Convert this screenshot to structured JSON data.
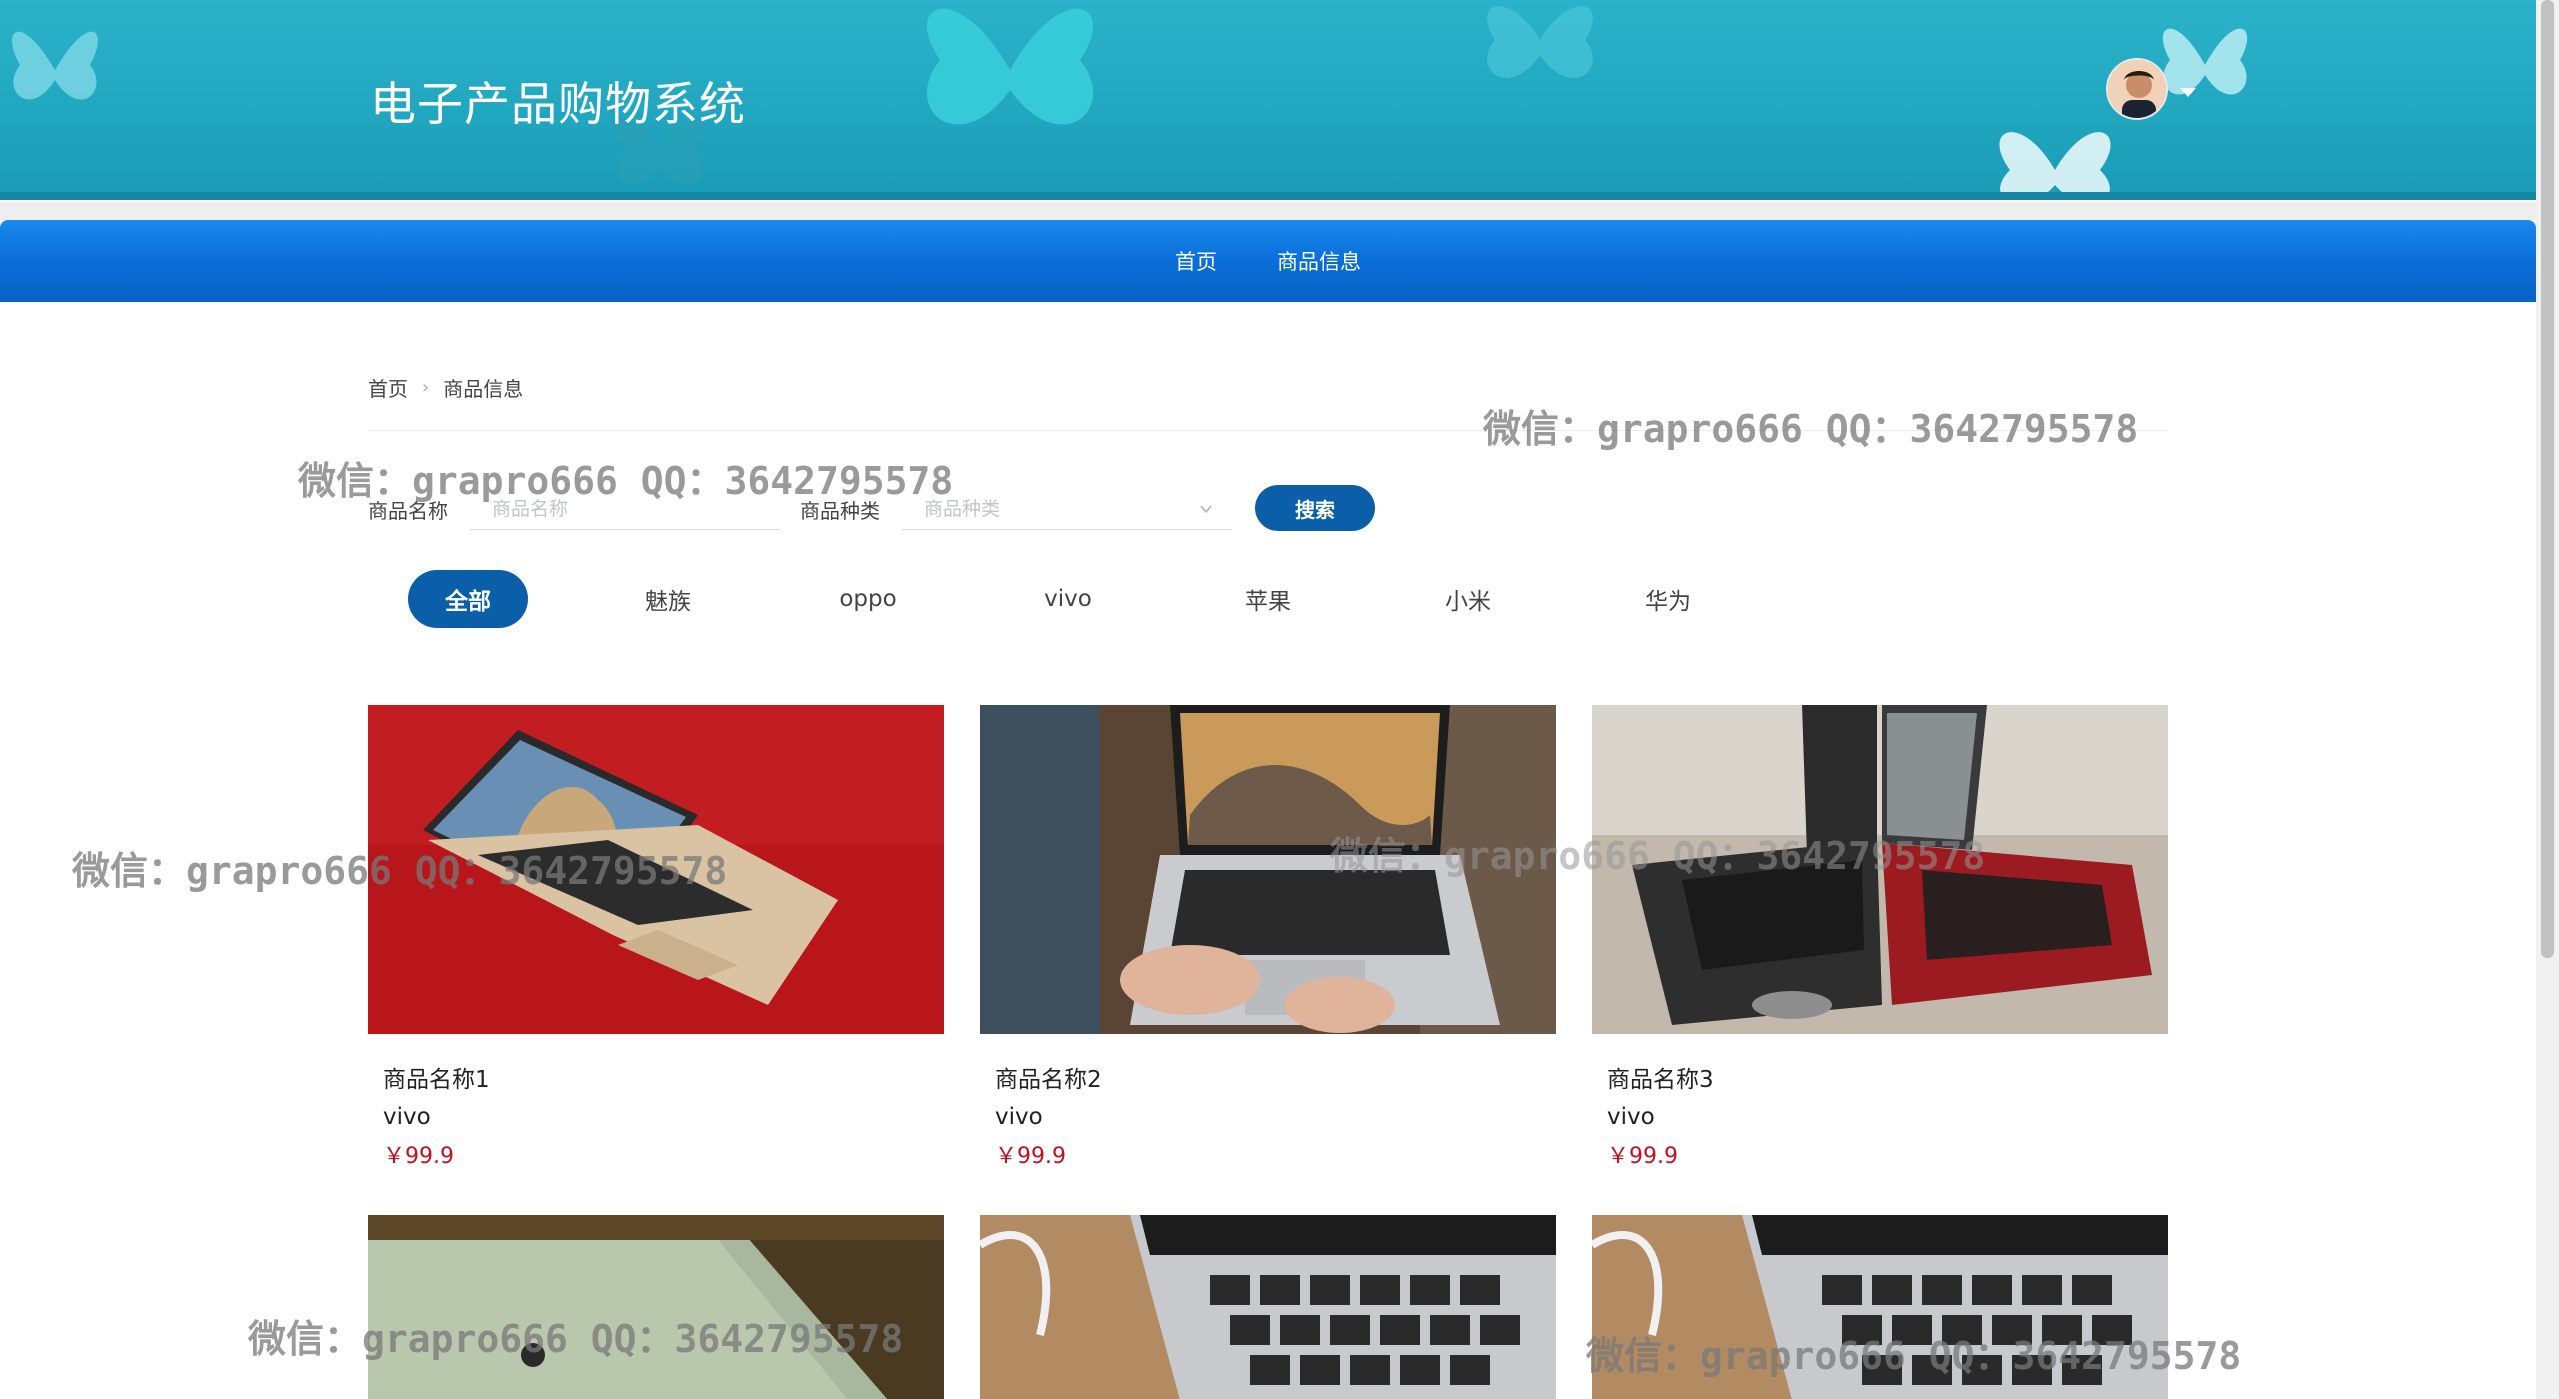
{
  "header": {
    "site_title": "电子产品购物系统"
  },
  "nav": {
    "items": [
      {
        "label": "首页"
      },
      {
        "label": "商品信息"
      }
    ]
  },
  "breadcrumb": {
    "home": "首页",
    "current": "商品信息"
  },
  "search": {
    "name_label": "商品名称",
    "name_placeholder": "商品名称",
    "type_label": "商品种类",
    "type_placeholder": "商品种类",
    "button_label": "搜索"
  },
  "categories": [
    {
      "label": "全部",
      "active": true
    },
    {
      "label": "魅族",
      "active": false
    },
    {
      "label": "oppo",
      "active": false
    },
    {
      "label": "vivo",
      "active": false
    },
    {
      "label": "苹果",
      "active": false
    },
    {
      "label": "小米",
      "active": false
    },
    {
      "label": "华为",
      "active": false
    }
  ],
  "products": [
    {
      "name": "商品名称1",
      "type": "vivo",
      "price": "￥99.9"
    },
    {
      "name": "商品名称2",
      "type": "vivo",
      "price": "￥99.9"
    },
    {
      "name": "商品名称3",
      "type": "vivo",
      "price": "￥99.9"
    }
  ],
  "watermark": {
    "text": "微信：grapro666 QQ：3642795578"
  },
  "colors": {
    "header_bg": "#21a7c0",
    "nav_bg": "#0a6ed8",
    "accent": "#0b5fa8",
    "price": "#c0101e"
  }
}
